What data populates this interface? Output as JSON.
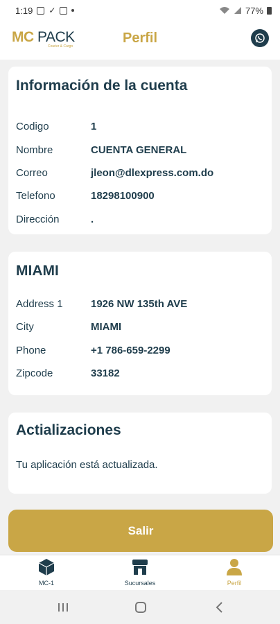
{
  "status_bar": {
    "time": "1:19",
    "battery": "77%"
  },
  "header": {
    "logo_mc": "MC",
    "logo_pack": " PACK",
    "logo_sub": "Courier & Cargo",
    "title": "Perfil"
  },
  "account_card": {
    "title": "Información de la cuenta",
    "rows": [
      {
        "label": "Codigo",
        "value": "1"
      },
      {
        "label": "Nombre",
        "value": "CUENTA GENERAL"
      },
      {
        "label": "Correo",
        "value": "jleon@dlexpress.com.do"
      },
      {
        "label": "Telefono",
        "value": "18298100900"
      },
      {
        "label": "Dirección",
        "value": "."
      }
    ]
  },
  "miami_card": {
    "title": "MIAMI",
    "rows": [
      {
        "label": "Address 1",
        "value": "1926 NW 135th AVE"
      },
      {
        "label": "City",
        "value": "MIAMI"
      },
      {
        "label": "Phone",
        "value": "+1 786-659-2299"
      },
      {
        "label": "Zipcode",
        "value": "33182"
      }
    ]
  },
  "updates_card": {
    "title": "Actializaciones",
    "message": "Tu aplicación está actualizada."
  },
  "logout_label": "Salir",
  "bottom_nav": {
    "items": [
      {
        "label": "MC-1"
      },
      {
        "label": "Sucursales"
      },
      {
        "label": "Perfil"
      }
    ]
  },
  "colors": {
    "gold": "#c9a646",
    "navy": "#1f3d4c"
  }
}
